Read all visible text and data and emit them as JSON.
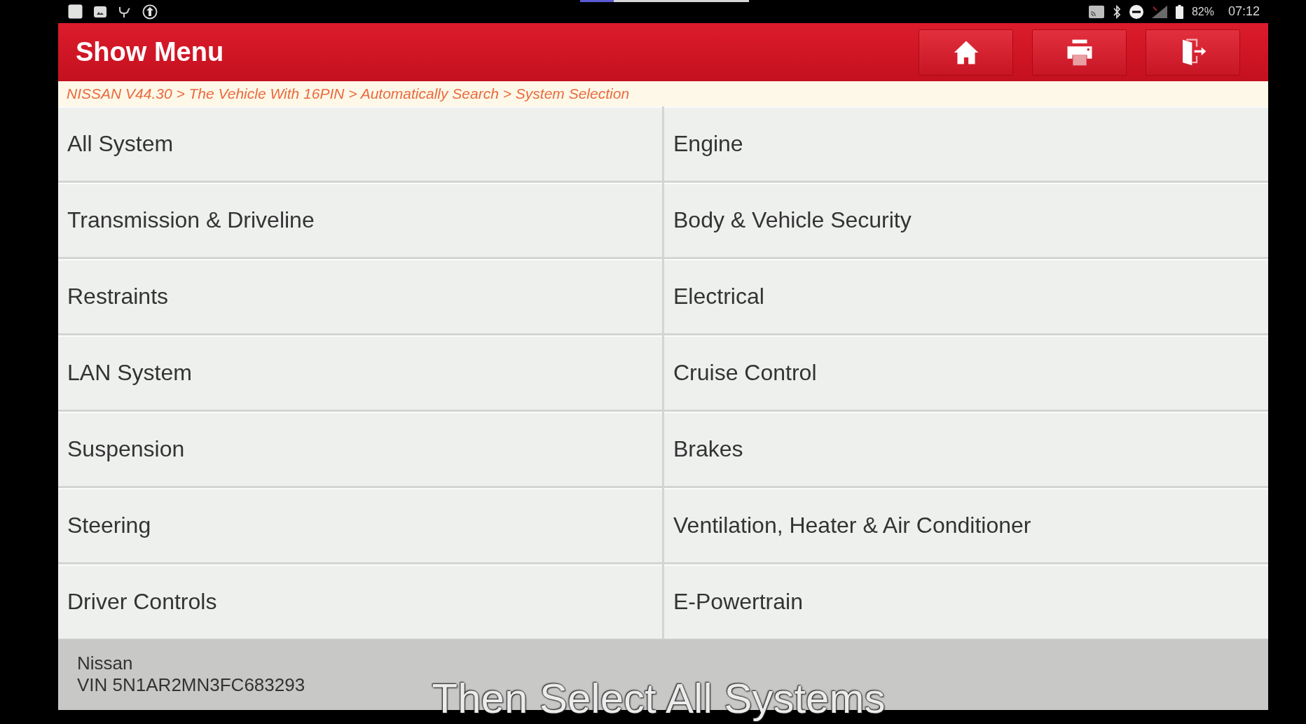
{
  "video_progress": {
    "level": 0.2
  },
  "status_bar": {
    "battery_text": "82%",
    "time": "07:12"
  },
  "header": {
    "title": "Show Menu"
  },
  "breadcrumb": "NISSAN V44.30 > The Vehicle With 16PIN > Automatically Search > System Selection",
  "systems": [
    "All System",
    "Engine",
    "Transmission & Driveline",
    "Body & Vehicle Security",
    "Restraints",
    "Electrical",
    "LAN System",
    "Cruise Control",
    "Suspension",
    "Brakes",
    "Steering",
    "Ventilation, Heater & Air Conditioner",
    "Driver Controls",
    "E-Powertrain"
  ],
  "footer": {
    "make": "Nissan",
    "vin": "VIN 5N1AR2MN3FC683293"
  },
  "subtitle": "Then Select All Systems"
}
